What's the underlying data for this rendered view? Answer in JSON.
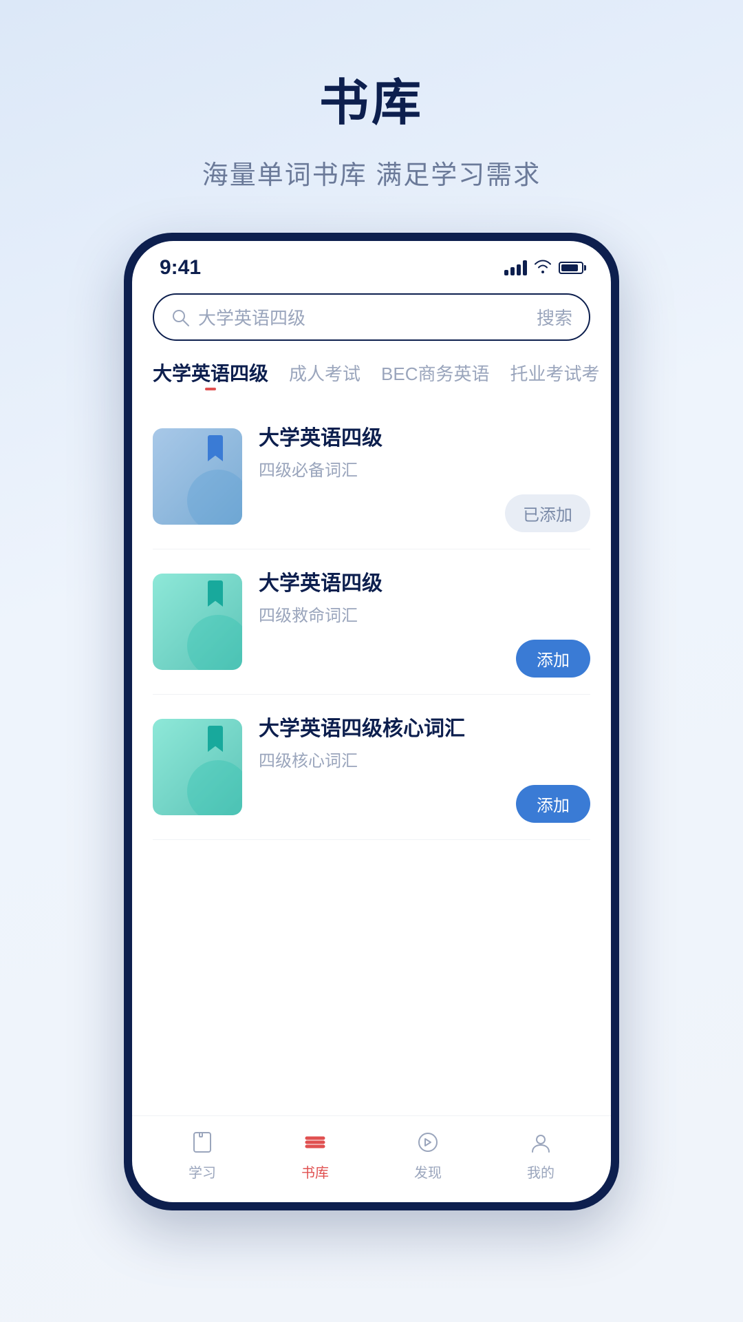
{
  "page": {
    "title": "书库",
    "subtitle": "海量单词书库 满足学习需求"
  },
  "status_bar": {
    "time": "9:41"
  },
  "search": {
    "placeholder": "大学英语四级",
    "button": "搜索"
  },
  "categories": [
    {
      "id": "cet4",
      "label": "大学英语四级",
      "active": true
    },
    {
      "id": "adult",
      "label": "成人考试",
      "active": false
    },
    {
      "id": "bec",
      "label": "BEC商务英语",
      "active": false
    },
    {
      "id": "toefl",
      "label": "托业考试考",
      "active": false
    }
  ],
  "books": [
    {
      "id": 1,
      "name": "大学英语四级",
      "description": "四级必备词汇",
      "cover_style": "1",
      "added": true,
      "btn_label_added": "已添加",
      "btn_label_add": "添加"
    },
    {
      "id": 2,
      "name": "大学英语四级",
      "description": "四级救命词汇",
      "cover_style": "2",
      "added": false,
      "btn_label_added": "已添加",
      "btn_label_add": "添加"
    },
    {
      "id": 3,
      "name": "大学英语四级核心词汇",
      "description": "四级核心词汇",
      "cover_style": "3",
      "added": false,
      "btn_label_added": "已添加",
      "btn_label_add": "添加"
    }
  ],
  "nav": {
    "items": [
      {
        "id": "study",
        "label": "学习",
        "active": false
      },
      {
        "id": "library",
        "label": "书库",
        "active": true
      },
      {
        "id": "discover",
        "label": "发现",
        "active": false
      },
      {
        "id": "mine",
        "label": "我的",
        "active": false
      }
    ]
  }
}
